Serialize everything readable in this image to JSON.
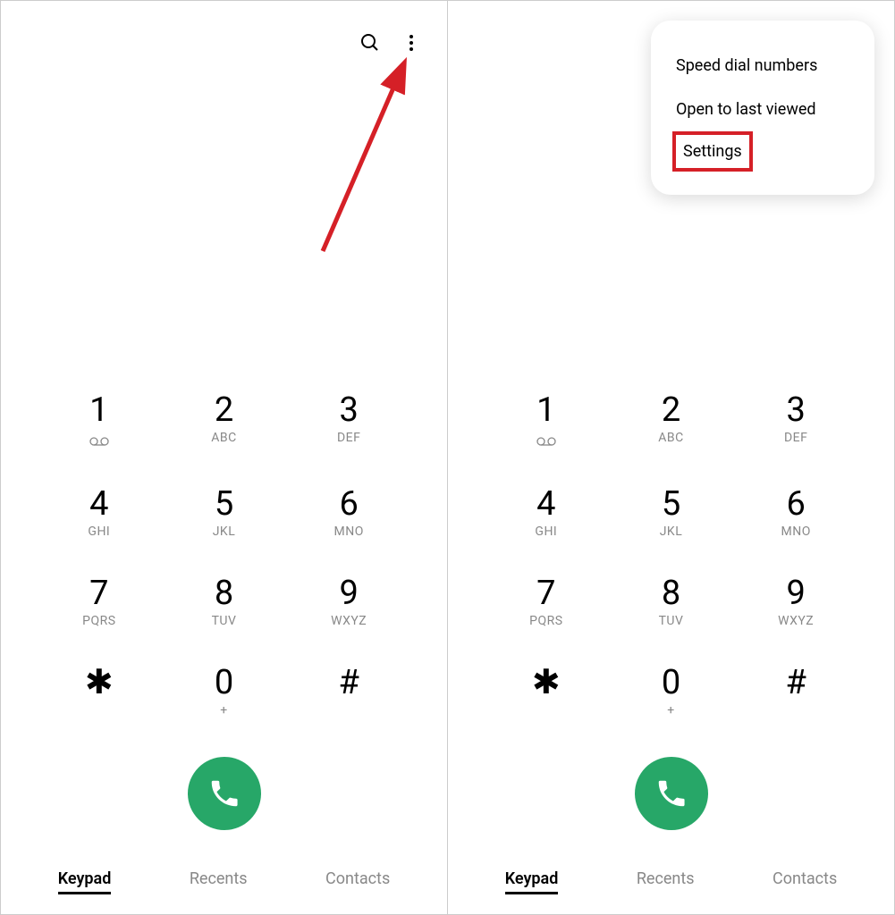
{
  "keypad": {
    "keys": [
      {
        "digit": "1",
        "letters": ""
      },
      {
        "digit": "2",
        "letters": "ABC"
      },
      {
        "digit": "3",
        "letters": "DEF"
      },
      {
        "digit": "4",
        "letters": "GHI"
      },
      {
        "digit": "5",
        "letters": "JKL"
      },
      {
        "digit": "6",
        "letters": "MNO"
      },
      {
        "digit": "7",
        "letters": "PQRS"
      },
      {
        "digit": "8",
        "letters": "TUV"
      },
      {
        "digit": "9",
        "letters": "WXYZ"
      },
      {
        "digit": "✱",
        "letters": ""
      },
      {
        "digit": "0",
        "letters": "+"
      },
      {
        "digit": "#",
        "letters": ""
      }
    ]
  },
  "tabs": {
    "keypad": "Keypad",
    "recents": "Recents",
    "contacts": "Contacts"
  },
  "menu": {
    "speed_dial": "Speed dial numbers",
    "open_last": "Open to last viewed",
    "settings": "Settings"
  },
  "colors": {
    "call_button": "#27a768",
    "highlight": "#d52027",
    "arrow": "#d52027"
  }
}
